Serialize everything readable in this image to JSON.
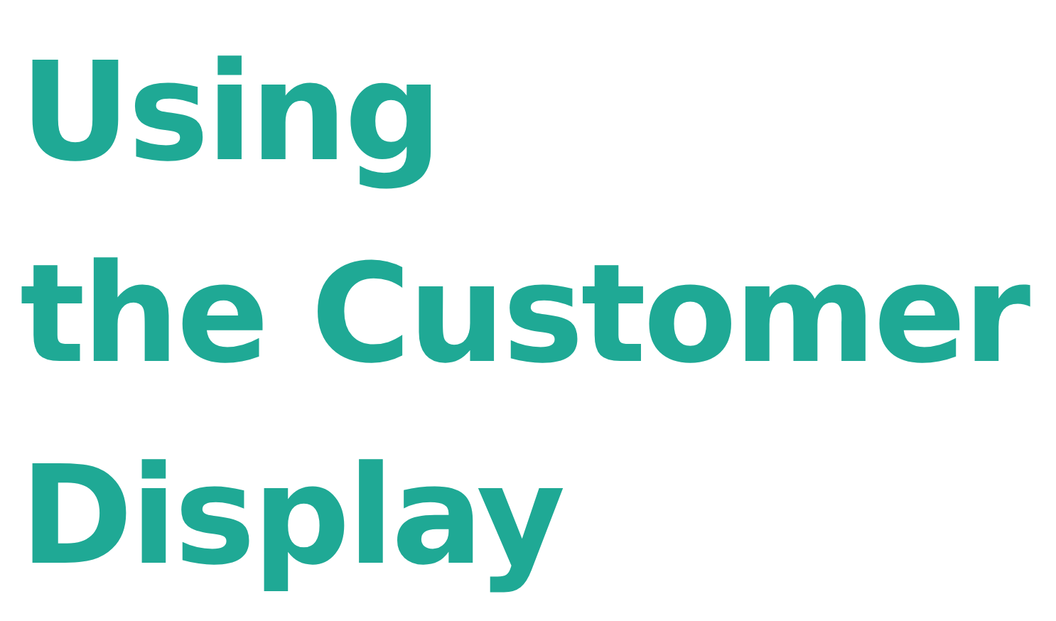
{
  "title": {
    "lines": [
      "Using",
      "the Customer",
      "Display"
    ]
  }
}
